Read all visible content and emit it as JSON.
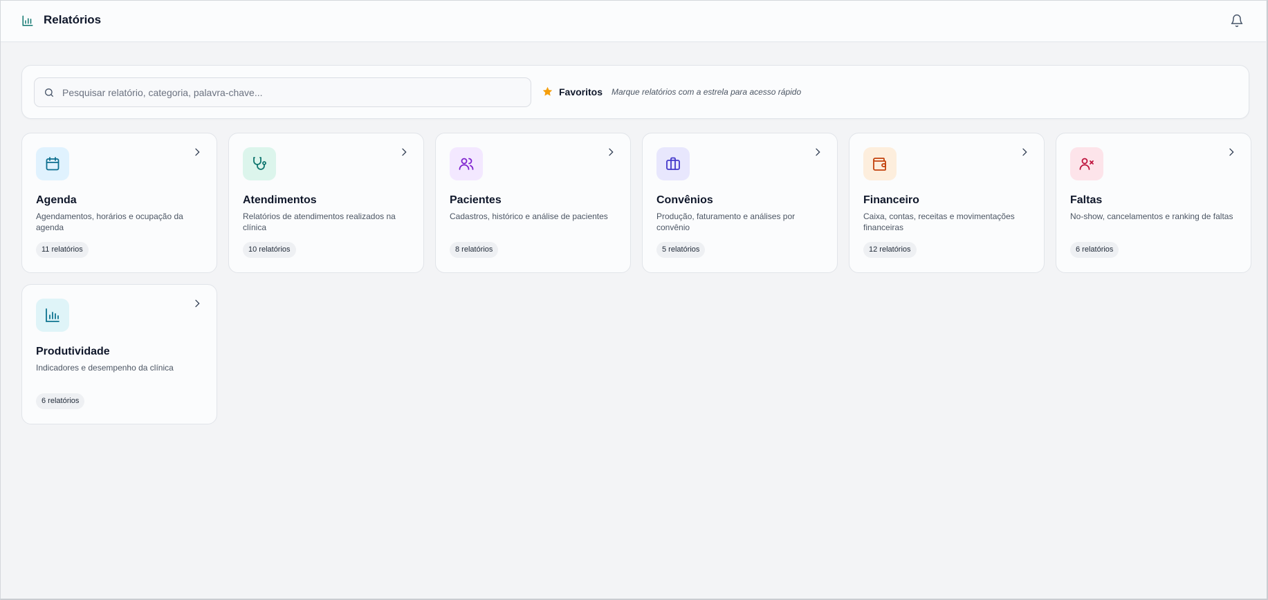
{
  "header": {
    "title": "Relatórios",
    "logo_icon": "bar-chart-icon",
    "notification_icon": "bell-icon"
  },
  "search": {
    "placeholder": "Pesquisar relatório, categoria, palavra-chave...",
    "value": ""
  },
  "favorites": {
    "label": "Favoritos",
    "hint": "Marque relatórios com a estrela para acesso rápido",
    "icon": "star-icon",
    "color": "#f59e0b"
  },
  "categories": [
    {
      "title": "Agenda",
      "description": "Agendamentos, horários e ocupação da agenda",
      "count": "11 relatórios",
      "icon": "calendar-icon",
      "icon_color": "#0c6e8f",
      "icon_bg": "#e0f2fe"
    },
    {
      "title": "Atendimentos",
      "description": "Relatórios de atendimentos realizados na clínica",
      "count": "10 relatórios",
      "icon": "stethoscope-icon",
      "icon_color": "#0f766e",
      "icon_bg": "#dcf5ec"
    },
    {
      "title": "Pacientes",
      "description": "Cadastros, histórico e análise de pacientes",
      "count": "8 relatórios",
      "icon": "users-icon",
      "icon_color": "#7e22ce",
      "icon_bg": "#f3e8ff"
    },
    {
      "title": "Convênios",
      "description": "Produção, faturamento e análises por convênio",
      "count": "5 relatórios",
      "icon": "briefcase-icon",
      "icon_color": "#4338ca",
      "icon_bg": "#e8e7fd"
    },
    {
      "title": "Financeiro",
      "description": "Caixa, contas, receitas e movimentações financeiras",
      "count": "12 relatórios",
      "icon": "wallet-icon",
      "icon_color": "#c2410c",
      "icon_bg": "#fdeedd"
    },
    {
      "title": "Faltas",
      "description": "No-show, cancelamentos e ranking de faltas",
      "count": "6 relatórios",
      "icon": "user-x-icon",
      "icon_color": "#be123c",
      "icon_bg": "#fde4ea"
    },
    {
      "title": "Produtividade",
      "description": "Indicadores e desempenho da clínica",
      "count": "6 relatórios",
      "icon": "bar-chart-icon",
      "icon_color": "#0e7490",
      "icon_bg": "#dff4f8"
    }
  ]
}
